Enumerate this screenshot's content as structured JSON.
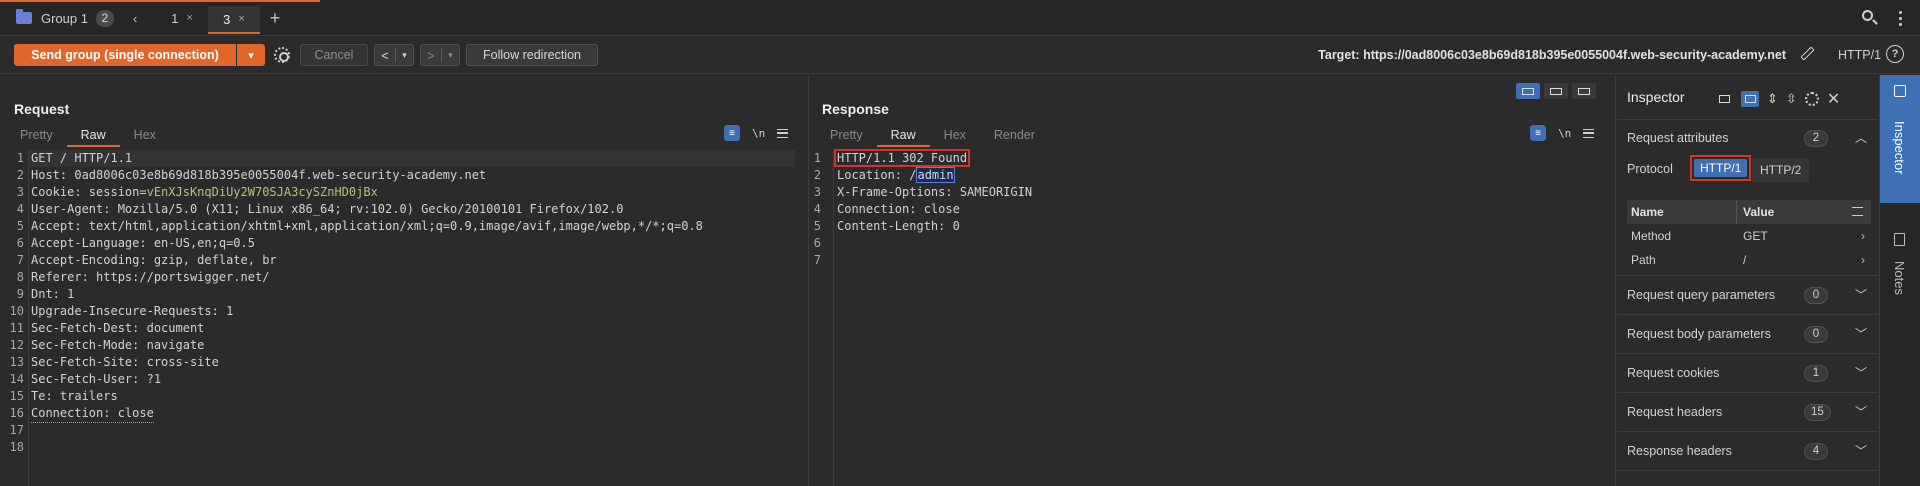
{
  "tabbar": {
    "group_label": "Group 1",
    "group_count": "2",
    "back_chevron": "‹",
    "tabs": [
      {
        "label": "1",
        "close": "×"
      },
      {
        "label": "3",
        "close": "×"
      }
    ],
    "add": "+",
    "icons": [
      "folder-icon",
      "chevron-left-icon",
      "close-icon",
      "plus-icon",
      "search-icon",
      "more-vertical-icon"
    ]
  },
  "toolbar": {
    "send_label": "Send group (single connection)",
    "send_dropdown": "▾",
    "cancel_label": "Cancel",
    "back_arrow": "<",
    "forward_arrow": ">",
    "dropdown_tri": "▾",
    "follow_label": "Follow redirection",
    "target_text": "Target: https://0ad8006c03e8b69d818b395e0055004f.web-security-academy.net",
    "http_version": "HTTP/1",
    "help": "?",
    "accent_color": "#e0662c"
  },
  "request": {
    "title": "Request",
    "tabs": [
      "Pretty",
      "Raw",
      "Hex"
    ],
    "active_tab": "Raw",
    "wrap_icon": "≡",
    "newline_icon": "\\n",
    "lines": [
      {
        "n": "1",
        "name": "",
        "value": "GET / HTTP/1.1"
      },
      {
        "n": "2",
        "name": "Host:",
        "value": " 0ad8006c03e8b69d818b395e0055004f.web-security-academy.net"
      },
      {
        "n": "3",
        "name": "Cookie:",
        "value": " session=",
        "cookie": "vEnXJsKnqDiUy2W70SJA3cySZnHD0jBx"
      },
      {
        "n": "4",
        "name": "User-Agent:",
        "value": " Mozilla/5.0 (X11; Linux x86_64; rv:102.0) Gecko/20100101 Firefox/102.0"
      },
      {
        "n": "5",
        "name": "Accept:",
        "value": " text/html,application/xhtml+xml,application/xml;q=0.9,image/avif,image/webp,*/*;q=0.8"
      },
      {
        "n": "6",
        "name": "Accept-Language:",
        "value": " en-US,en;q=0.5"
      },
      {
        "n": "7",
        "name": "Accept-Encoding:",
        "value": " gzip, deflate, br"
      },
      {
        "n": "8",
        "name": "Referer:",
        "value": " https://portswigger.net/"
      },
      {
        "n": "9",
        "name": "Dnt:",
        "value": " 1"
      },
      {
        "n": "10",
        "name": "Upgrade-Insecure-Requests:",
        "value": " 1"
      },
      {
        "n": "11",
        "name": "Sec-Fetch-Dest:",
        "value": " document"
      },
      {
        "n": "12",
        "name": "Sec-Fetch-Mode:",
        "value": " navigate"
      },
      {
        "n": "13",
        "name": "Sec-Fetch-Site:",
        "value": " cross-site"
      },
      {
        "n": "14",
        "name": "Sec-Fetch-User:",
        "value": " ?1"
      },
      {
        "n": "15",
        "name": "Te:",
        "value": " trailers"
      },
      {
        "n": "16",
        "name": "Connection:",
        "value": " close"
      },
      {
        "n": "17",
        "name": "",
        "value": ""
      },
      {
        "n": "18",
        "name": "",
        "value": ""
      }
    ]
  },
  "response": {
    "title": "Response",
    "tabs": [
      "Pretty",
      "Raw",
      "Hex",
      "Render"
    ],
    "active_tab": "Raw",
    "lines": [
      {
        "n": "1",
        "text": "HTTP/1.1 302 Found"
      },
      {
        "n": "2",
        "name": "Location:",
        "pre": " /",
        "highlight": "admin"
      },
      {
        "n": "3",
        "name": "X-Frame-Options:",
        "value": " SAMEORIGIN"
      },
      {
        "n": "4",
        "name": "Connection:",
        "value": " close"
      },
      {
        "n": "5",
        "name": "Content-Length:",
        "value": " 0"
      },
      {
        "n": "6",
        "text": ""
      },
      {
        "n": "7",
        "text": ""
      }
    ]
  },
  "inspector": {
    "title": "Inspector",
    "attributes": {
      "label": "Request attributes",
      "count": "2",
      "protocol_label": "Protocol",
      "protocol_options": [
        "HTTP/1",
        "HTTP/2"
      ],
      "protocol_selected": "HTTP/1",
      "table_headers": [
        "Name",
        "Value"
      ],
      "rows": [
        {
          "name": "Method",
          "value": "GET"
        },
        {
          "name": "Path",
          "value": "/"
        }
      ]
    },
    "sections": [
      {
        "label": "Request query parameters",
        "count": "0"
      },
      {
        "label": "Request body parameters",
        "count": "0"
      },
      {
        "label": "Request cookies",
        "count": "1"
      },
      {
        "label": "Request headers",
        "count": "15"
      },
      {
        "label": "Response headers",
        "count": "4"
      }
    ]
  },
  "sidebar": {
    "inspector_label": "Inspector",
    "notes_label": "Notes"
  }
}
